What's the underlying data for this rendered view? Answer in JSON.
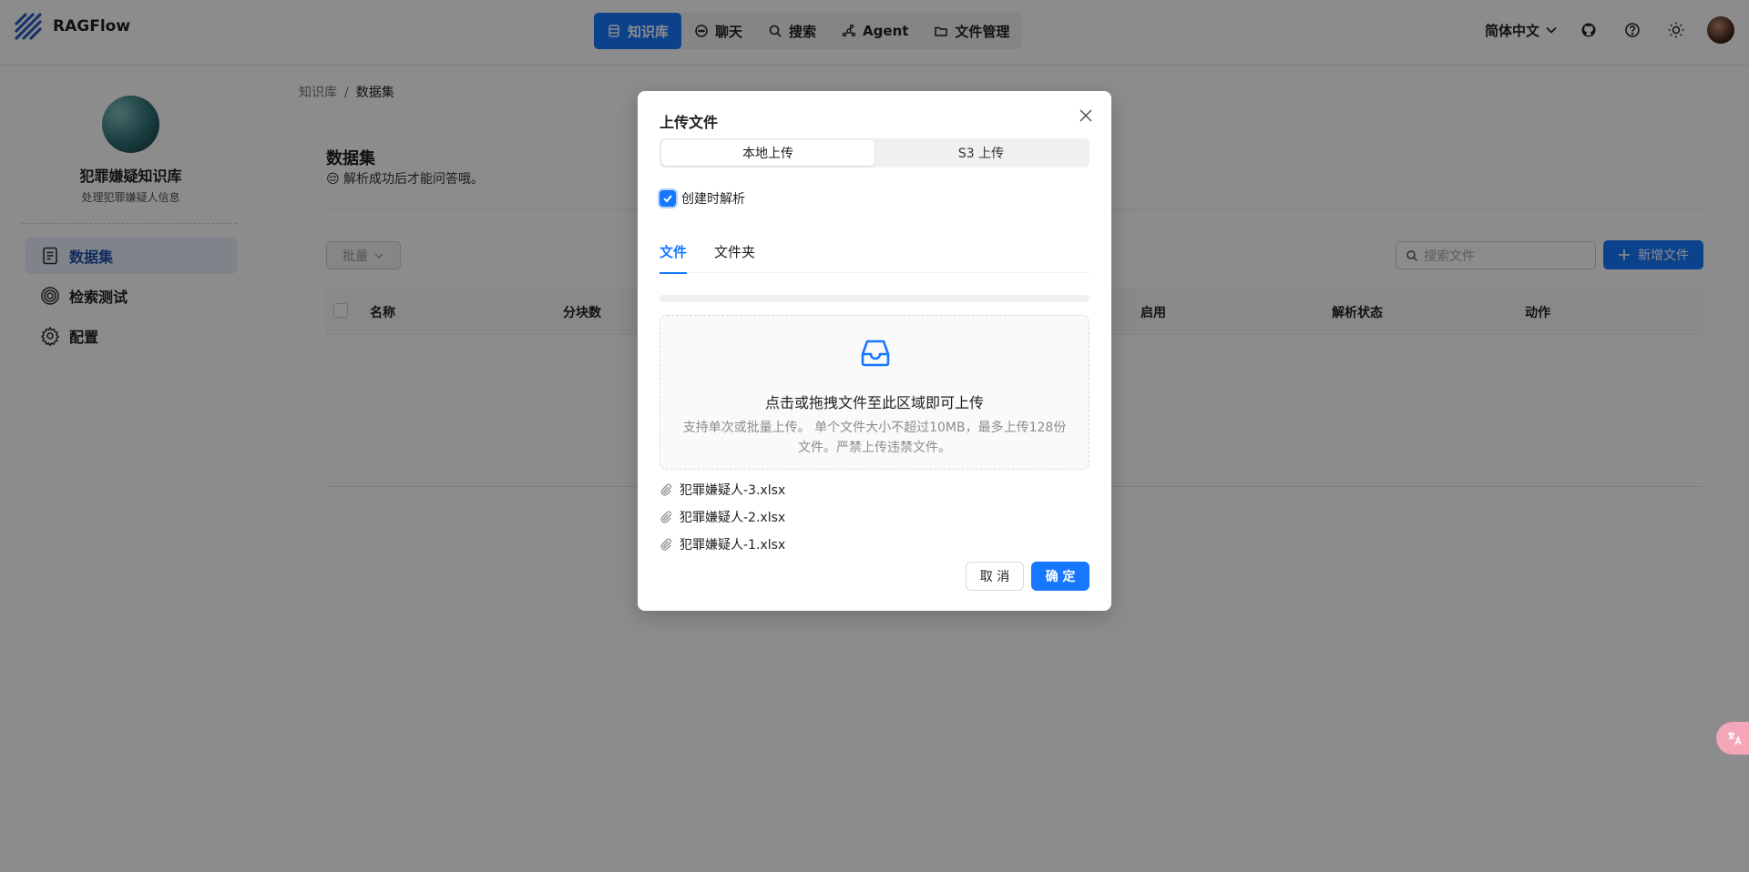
{
  "app": {
    "name": "RAGFlow"
  },
  "nav": {
    "items": [
      {
        "label": "知识库",
        "icon": "database-icon",
        "active": true
      },
      {
        "label": "聊天",
        "icon": "chat-icon"
      },
      {
        "label": "搜索",
        "icon": "search-icon"
      },
      {
        "label": "Agent",
        "icon": "agent-icon"
      },
      {
        "label": "文件管理",
        "icon": "folder-icon"
      }
    ]
  },
  "header": {
    "language": "简体中文"
  },
  "sidebar": {
    "kb_name": "犯罪嫌疑知识库",
    "kb_desc": "处理犯罪嫌疑人信息",
    "items": [
      {
        "label": "数据集",
        "icon": "document-icon",
        "active": true
      },
      {
        "label": "检索测试",
        "icon": "target-icon"
      },
      {
        "label": "配置",
        "icon": "gear-icon"
      }
    ]
  },
  "breadcrumb": {
    "root": "知识库",
    "sep": "/",
    "current": "数据集"
  },
  "main": {
    "title": "数据集",
    "subtitle": "😔 解析成功后才能问答哦。",
    "bulk_label": "批量",
    "search_placeholder": "搜索文件",
    "add_label": "新增文件",
    "columns": [
      "名称",
      "分块数",
      "启用",
      "解析状态",
      "动作"
    ]
  },
  "modal": {
    "title": "上传文件",
    "segments": [
      {
        "label": "本地上传",
        "active": true
      },
      {
        "label": "S3 上传"
      }
    ],
    "checkbox_label": "创建时解析",
    "checkbox_checked": true,
    "tabs": [
      {
        "label": "文件",
        "active": true
      },
      {
        "label": "文件夹"
      }
    ],
    "progress": 0,
    "drop_title": "点击或拖拽文件至此区域即可上传",
    "drop_hint": "支持单次或批量上传。 单个文件大小不超过10MB，最多上传128份文件。严禁上传违禁文件。",
    "files": [
      "犯罪嫌疑人-3.xlsx",
      "犯罪嫌疑人-2.xlsx",
      "犯罪嫌疑人-1.xlsx"
    ],
    "cancel_label": "取 消",
    "ok_label": "确 定"
  },
  "colors": {
    "primary": "#1677ff",
    "overlay": "rgba(0,0,0,0.45)"
  }
}
